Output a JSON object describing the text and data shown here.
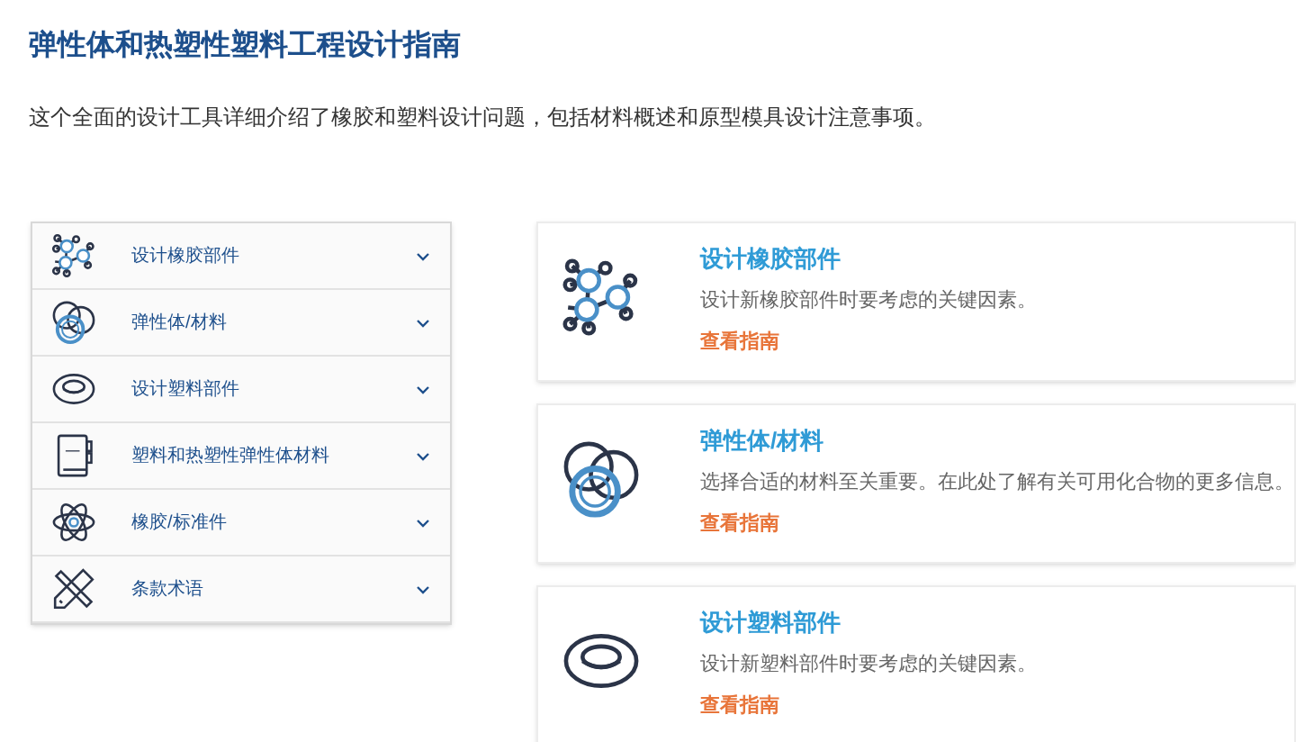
{
  "title": "弹性体和热塑性塑料工程设计指南",
  "description": "这个全面的设计工具详细介绍了橡胶和塑料设计问题，包括材料概述和原型模具设计注意事项。",
  "sidebar": {
    "items": [
      {
        "kind": "network",
        "label": "设计橡胶部件",
        "expanded": false
      },
      {
        "kind": "rings",
        "label": "弹性体/材料",
        "expanded": false
      },
      {
        "kind": "ring",
        "label": "设计塑料部件",
        "expanded": false
      },
      {
        "kind": "book",
        "label": "塑料和热塑性弹性体材料",
        "expanded": false
      },
      {
        "kind": "atom",
        "label": "橡胶/标准件",
        "expanded": false
      },
      {
        "kind": "tools",
        "label": "条款术语",
        "expanded": false
      }
    ]
  },
  "cards": [
    {
      "kind": "network",
      "title": "设计橡胶部件",
      "text": "设计新橡胶部件时要考虑的关键因素。",
      "link": "查看指南"
    },
    {
      "kind": "rings",
      "title": "弹性体/材料",
      "text": "选择合适的材料至关重要。在此处了解有关可用化合物的更多信息。",
      "link": "查看指南"
    },
    {
      "kind": "ring",
      "title": "设计塑料部件",
      "text": "设计新塑料部件时要考虑的关键因素。",
      "link": "查看指南"
    }
  ]
}
